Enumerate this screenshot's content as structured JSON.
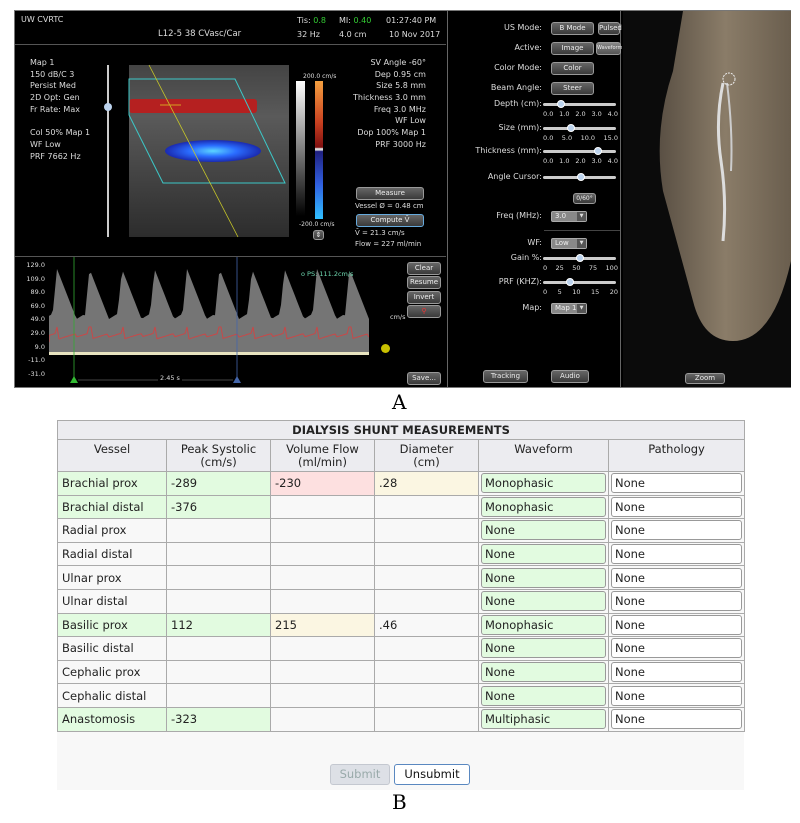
{
  "figure_a": {
    "label": "A",
    "header": {
      "site": "UW CVRTC",
      "probe": "L12-5 38 CVasc/Car",
      "tis_label": "Tis:",
      "tis_value": "0.8",
      "mi_label": "MI:",
      "mi_value": "0.40",
      "time": "01:27:40 PM",
      "frame_rate": "32 Hz",
      "depth": "4.0 cm",
      "date": "10 Nov 2017"
    },
    "left_info": [
      "Map 1",
      "150 dB/C 3",
      "Persist Med",
      "2D Opt: Gen",
      "Fr Rate: Max",
      "",
      "Col 50% Map 1",
      "WF Low",
      "PRF  7662 Hz"
    ],
    "right_info": [
      "SV Angle -60°",
      "Dep 0.95 cm",
      "Size  5.8 mm",
      "Thickness  3.0 mm",
      "Freq 3.0 MHz",
      "WF Low",
      "Dop 100% Map 1",
      "PRF  3000 Hz"
    ],
    "color_scale": {
      "top": "200.0 cm/s",
      "bottom": "-200.0 cm/s"
    },
    "measure_button": "Measure",
    "vessel_diameter": "Vessel Ø = 0.48 cm",
    "compute_button": "Compute V̄",
    "mean_velocity": "V̄  = 21.3 cm/s",
    "flow": "Flow = 227 ml/min",
    "waveform": {
      "y_ticks": [
        "129.0",
        "109.0",
        "89.0",
        "69.0",
        "49.0",
        "29.0",
        "9.0",
        "-11.0",
        "-31.0"
      ],
      "peak_label": "o PS: 111.2cm/s",
      "unit": "cm/s",
      "interval": "2.45 s",
      "buttons": [
        "Clear",
        "Resume",
        "Invert",
        "",
        "Save..."
      ]
    },
    "controls": {
      "us_mode_label": "US Mode:",
      "us_mode_options": [
        "B Mode",
        "Pulsed"
      ],
      "active_label": "Active:",
      "active_options": [
        "Image",
        "Waveform"
      ],
      "color_mode_label": "Color Mode:",
      "color_mode_button": "Color",
      "beam_angle_label": "Beam Angle:",
      "beam_angle_button": "Steer",
      "sliders": [
        {
          "label": "Depth (cm):",
          "ticks": [
            "0.0",
            "1.0",
            "2.0",
            "3.0",
            "4.0"
          ],
          "value": 1.0,
          "min": 0,
          "max": 4
        },
        {
          "label": "Size (mm):",
          "ticks": [
            "0.0",
            "5.0",
            "10.0",
            "15.0"
          ],
          "value": 5.8,
          "min": 0,
          "max": 15
        },
        {
          "label": "Thickness (mm):",
          "ticks": [
            "0.0",
            "1.0",
            "2.0",
            "3.0",
            "4.0"
          ],
          "value": 3.0,
          "min": 0,
          "max": 4
        },
        {
          "label": "Angle Cursor:",
          "ticks": [],
          "value": 0.52,
          "min": 0,
          "max": 1
        }
      ],
      "angle_button": "0/60°",
      "freq_label": "Freq (MHz):",
      "freq_value": "3.0",
      "wf_label": "WF:",
      "wf_value": "Low",
      "sliders2": [
        {
          "label": "Gain %:",
          "ticks": [
            "0",
            "25",
            "50",
            "75",
            "100"
          ],
          "value": 50,
          "min": 0,
          "max": 100
        },
        {
          "label": "PRF (KHZ):",
          "ticks": [
            "0",
            "5",
            "10",
            "15",
            "20"
          ],
          "value": 7.5,
          "min": 0,
          "max": 20
        }
      ],
      "map_label": "Map:",
      "map_value": "Map 1",
      "tracking_button": "Tracking",
      "audio_button": "Audio"
    },
    "zoom_button": "Zoom"
  },
  "figure_b": {
    "label": "B",
    "title": "DIALYSIS SHUNT MEASUREMENTS",
    "columns": [
      "Vessel",
      "Peak Systolic\n(cm/s)",
      "Volume Flow\n(ml/min)",
      "Diameter\n(cm)",
      "Waveform",
      "Pathology"
    ],
    "rows": [
      {
        "vessel": "Brachial prox",
        "vessel_color": "g",
        "peak": "-289",
        "peak_color": "g",
        "volume": "-230",
        "volume_color": "r",
        "diameter": ".28",
        "diameter_color": "y",
        "waveform": "Monophasic",
        "pathology": "None"
      },
      {
        "vessel": "Brachial distal",
        "vessel_color": "g",
        "peak": "-376",
        "peak_color": "g",
        "volume": "",
        "volume_color": "",
        "diameter": "",
        "diameter_color": "",
        "waveform": "Monophasic",
        "pathology": "None"
      },
      {
        "vessel": "Radial prox",
        "vessel_color": "",
        "peak": "",
        "peak_color": "",
        "volume": "",
        "volume_color": "",
        "diameter": "",
        "diameter_color": "",
        "waveform": "None",
        "pathology": "None"
      },
      {
        "vessel": "Radial distal",
        "vessel_color": "",
        "peak": "",
        "peak_color": "",
        "volume": "",
        "volume_color": "",
        "diameter": "",
        "diameter_color": "",
        "waveform": "None",
        "pathology": "None"
      },
      {
        "vessel": "Ulnar prox",
        "vessel_color": "",
        "peak": "",
        "peak_color": "",
        "volume": "",
        "volume_color": "",
        "diameter": "",
        "diameter_color": "",
        "waveform": "None",
        "pathology": "None"
      },
      {
        "vessel": "Ulnar distal",
        "vessel_color": "",
        "peak": "",
        "peak_color": "",
        "volume": "",
        "volume_color": "",
        "diameter": "",
        "diameter_color": "",
        "waveform": "None",
        "pathology": "None"
      },
      {
        "vessel": "Basilic prox",
        "vessel_color": "g",
        "peak": "112",
        "peak_color": "g",
        "volume": "215",
        "volume_color": "y",
        "diameter": ".46",
        "diameter_color": "",
        "waveform": "Monophasic",
        "pathology": "None"
      },
      {
        "vessel": "Basilic distal",
        "vessel_color": "",
        "peak": "",
        "peak_color": "",
        "volume": "",
        "volume_color": "",
        "diameter": "",
        "diameter_color": "",
        "waveform": "None",
        "pathology": "None"
      },
      {
        "vessel": "Cephalic prox",
        "vessel_color": "",
        "peak": "",
        "peak_color": "",
        "volume": "",
        "volume_color": "",
        "diameter": "",
        "diameter_color": "",
        "waveform": "None",
        "pathology": "None"
      },
      {
        "vessel": "Cephalic distal",
        "vessel_color": "",
        "peak": "",
        "peak_color": "",
        "volume": "",
        "volume_color": "",
        "diameter": "",
        "diameter_color": "",
        "waveform": "None",
        "pathology": "None"
      },
      {
        "vessel": "Anastomosis",
        "vessel_color": "g",
        "peak": "-323",
        "peak_color": "g",
        "volume": "",
        "volume_color": "",
        "diameter": "",
        "diameter_color": "",
        "waveform": "Multiphasic",
        "pathology": "None"
      }
    ],
    "submit_button": "Submit",
    "unsubmit_button": "Unsubmit"
  },
  "colors": {
    "flow_red": "#b52020",
    "flow_blue": "#2a5cff",
    "roi_cyan": "#3cc8c8",
    "cursor_yellow": "#c8c828",
    "filled_green": "#e2fbe0",
    "flagged_red": "#fde0e0",
    "computed_yellow": "#fbf6e2"
  }
}
